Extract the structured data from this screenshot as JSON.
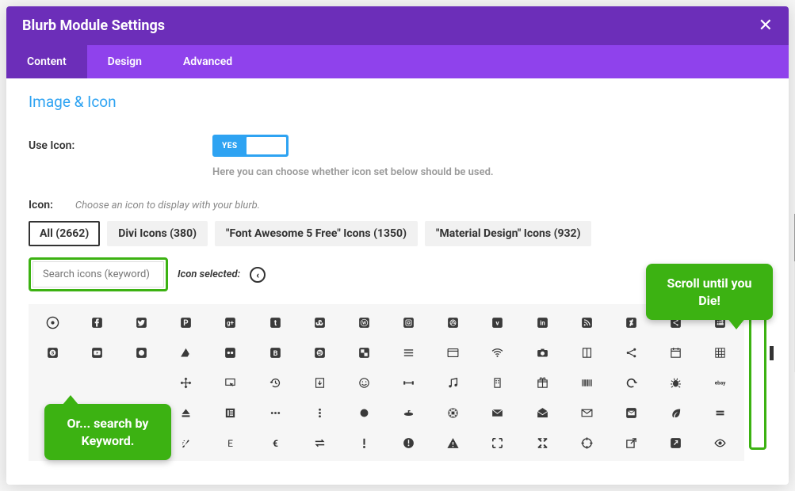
{
  "header": {
    "title": "Blurb Module Settings"
  },
  "tabs": [
    {
      "label": "Content",
      "active": true
    },
    {
      "label": "Design",
      "active": false
    },
    {
      "label": "Advanced",
      "active": false
    }
  ],
  "section": {
    "title": "Image & Icon"
  },
  "useIcon": {
    "label": "Use Icon:",
    "toggle": "YES",
    "help": "Here you can choose whether icon set below should be used."
  },
  "iconRow": {
    "label": "Icon:",
    "help": "Choose an icon to display with your blurb."
  },
  "filters": [
    {
      "label": "All (2662)",
      "active": true
    },
    {
      "label": "Divi Icons (380)",
      "active": false
    },
    {
      "label": "\"Font Awesome 5 Free\" Icons (1350)",
      "active": false
    },
    {
      "label": "\"Material Design\" Icons (932)",
      "active": false
    }
  ],
  "search": {
    "placeholder": "Search icons (keyword)",
    "selectedLabel": "Icon selected:",
    "selectedGlyph": "‹"
  },
  "callouts": {
    "scroll": "Scroll until you Die!",
    "search": "Or... search by Keyword."
  }
}
